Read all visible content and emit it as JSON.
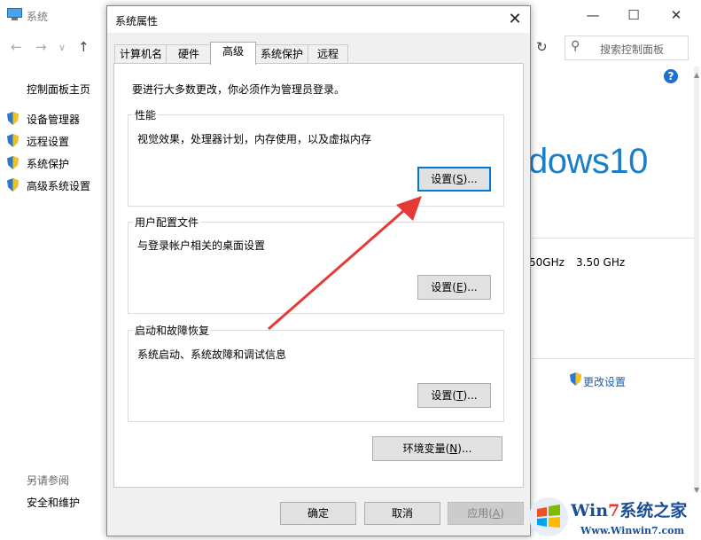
{
  "background_window": {
    "title": "系统",
    "breadcrumb_icon": "system-icon",
    "search_placeholder": "搜索控制面板",
    "left_nav": {
      "home": "控制面板主页",
      "items": [
        "设备管理器",
        "远程设置",
        "系统保护",
        "高级系统设置"
      ],
      "see_also_label": "另请参阅",
      "see_also_items": [
        "安全和维护"
      ]
    },
    "windows_logo_text": "dows10",
    "cpu_speed": "50GHz",
    "cpu_speed2": "3.50 GHz",
    "change_settings": "更改设置"
  },
  "dialog": {
    "title": "系统属性",
    "tabs": [
      "计算机名",
      "硬件",
      "高级",
      "系统保护",
      "远程"
    ],
    "active_tab": "高级",
    "admin_note": "要进行大多数更改，你必须作为管理员登录。",
    "performance": {
      "label": "性能",
      "desc": "视觉效果，处理器计划，内存使用，以及虚拟内存",
      "button_pre": "设置(",
      "button_key": "S",
      "button_post": ")..."
    },
    "user_profiles": {
      "label": "用户配置文件",
      "desc": "与登录帐户相关的桌面设置",
      "button_pre": "设置(",
      "button_key": "E",
      "button_post": ")..."
    },
    "startup_recovery": {
      "label": "启动和故障恢复",
      "desc": "系统启动、系统故障和调试信息",
      "button_pre": "设置(",
      "button_key": "T",
      "button_post": ")..."
    },
    "env_vars": {
      "pre": "环境变量(",
      "key": "N",
      "post": ")..."
    },
    "ok_label": "确定",
    "cancel_label": "取消",
    "apply": {
      "pre": "应用(",
      "key": "A",
      "post": ")"
    }
  },
  "watermark": {
    "brand_pre": "Win",
    "brand_num": "7",
    "brand_post": "系统之家",
    "url": "Www.Winwin7.com"
  },
  "colors": {
    "accent_blue": "#1a7ec8",
    "focus_border": "#0078d7",
    "annotation_arrow": "#e53935"
  }
}
